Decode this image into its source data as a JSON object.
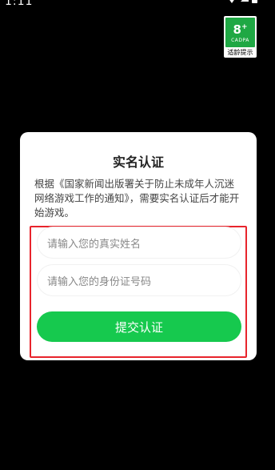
{
  "status_bar": {
    "time": "1:11"
  },
  "age_badge": {
    "rating": "8",
    "plus": "+",
    "org": "CADPA",
    "caption": "适龄提示",
    "color": "#1fa844"
  },
  "dialog": {
    "title": "实名认证",
    "description": "根据《国家新闻出版署关于防止未成年人沉迷网络游戏工作的通知》，需要实名认证后才能开始游戏。",
    "name_placeholder": "请输入您的真实姓名",
    "id_placeholder": "请输入您的身份证号码",
    "submit_label": "提交认证",
    "accent_color": "#16c94e",
    "highlight_color": "#e8242c"
  }
}
